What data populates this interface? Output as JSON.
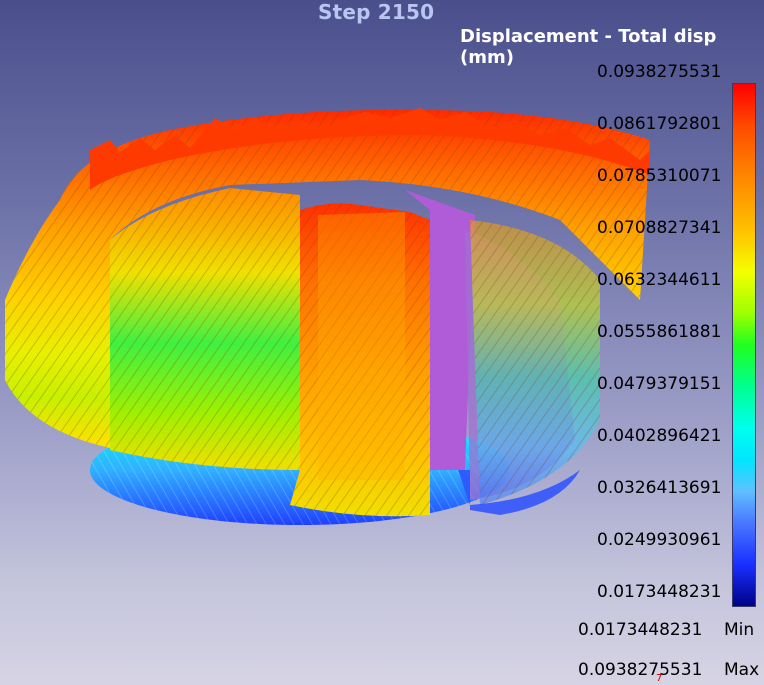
{
  "step_title": "Step 2150",
  "legend_title": "Displacement - Total disp (mm)",
  "colorbar_ticks": [
    "0.0938275531",
    "0.0861792801",
    "0.0785310071",
    "0.0708827341",
    "0.0632344611",
    "0.0555861881",
    "0.0479379151",
    "0.0402896421",
    "0.0326413691",
    "0.0249930961",
    "0.0173448231"
  ],
  "min_value": "0.0173448231",
  "min_label": "Min",
  "max_value": "0.0938275531",
  "max_label": "Max",
  "axis_marker": "7",
  "colors": {
    "max": "#ff0000",
    "mid": "#20ff20",
    "min": "#000088",
    "inner_surface": "#b05cd8"
  }
}
